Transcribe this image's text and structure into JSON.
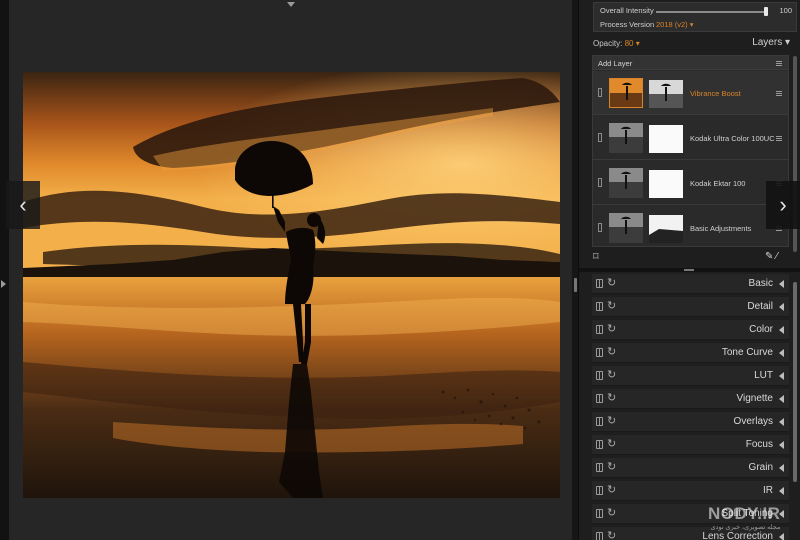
{
  "canvas": {
    "nav_prev_glyph": "‹",
    "nav_next_glyph": "›"
  },
  "top_settings": {
    "intensity_label": "Overall Intensity",
    "intensity_value": "100",
    "intensity_level": 1.0,
    "process_label": "Process Version",
    "process_value": "2018 (v2) ▾"
  },
  "layers_header": {
    "opacity_label": "Opacity:",
    "opacity_value": "80 ▾",
    "title": "Layers ▾"
  },
  "layers": {
    "add_label": "Add Layer",
    "items": [
      {
        "name": "Vibrance Boost",
        "active": true
      },
      {
        "name": "Kodak Ultra Color 100UC",
        "active": false
      },
      {
        "name": "Kodak Ektar 100",
        "active": false
      },
      {
        "name": "Basic Adjustments",
        "active": false
      }
    ]
  },
  "tools": {
    "crop_glyph": "⌑",
    "brush_glyph": "✎ ⁄"
  },
  "adjustments": {
    "reset_glyph": "↻",
    "items": [
      "Basic",
      "Detail",
      "Color",
      "Tone Curve",
      "LUT",
      "Vignette",
      "Overlays",
      "Focus",
      "Grain",
      "IR",
      "Split Toning",
      "Lens Correction"
    ]
  },
  "watermark": {
    "logo": "NODY.IR",
    "subtitle": "مجله تصویری، خبری نودی"
  },
  "colors": {
    "accent_orange": "#d8842a",
    "panel_bg": "#1e1e1e",
    "canvas_bg": "#262626"
  }
}
